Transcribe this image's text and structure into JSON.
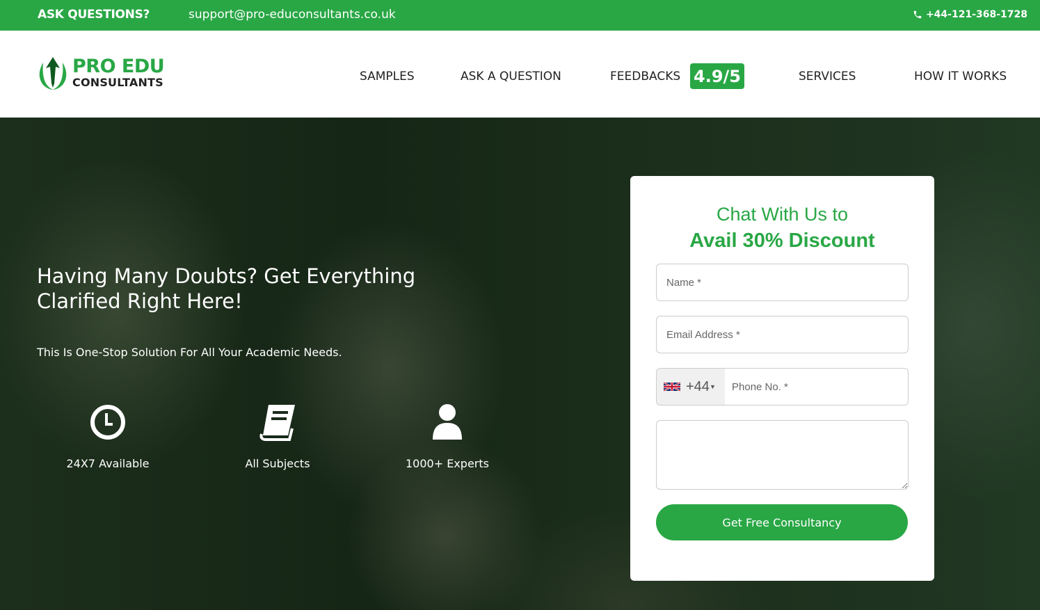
{
  "topbar": {
    "ask_label": "ASK QUESTIONS?",
    "email": "support@pro-educonsultants.co.uk",
    "phone": "+44-121-368-1728",
    "phone_icon": "phone-icon"
  },
  "brand": {
    "line1": "PRO EDU",
    "line2": "CONSULTANTS",
    "accent_color": "#29a745"
  },
  "nav": {
    "items": [
      {
        "label": "SAMPLES"
      },
      {
        "label": "ASK A QUESTION"
      },
      {
        "label": "FEEDBACKS",
        "badge": "4.9/5"
      },
      {
        "label": "SERVICES"
      },
      {
        "label": "HOW IT WORKS"
      }
    ]
  },
  "hero": {
    "title": "Having Many Doubts? Get Everything Clarified Right Here!",
    "subtitle": "This Is One-Stop Solution For All Your Academic Needs.",
    "features": [
      {
        "icon": "clock-icon",
        "label": "24X7 Available"
      },
      {
        "icon": "book-icon",
        "label": "All Subjects"
      },
      {
        "icon": "user-icon",
        "label": "1000+ Experts"
      }
    ]
  },
  "form": {
    "title_line1": "Chat With Us to",
    "title_line2": "Avail 30% Discount",
    "name_placeholder": "Name *",
    "email_placeholder": "Email Address *",
    "country_flag": "uk-flag-icon",
    "country_code": "+44",
    "phone_placeholder": "Phone No. *",
    "message_value": "",
    "submit_label": "Get Free Consultancy"
  }
}
